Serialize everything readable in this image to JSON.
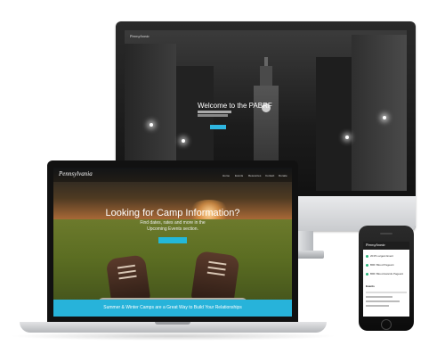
{
  "imac": {
    "logo_text": "Pennsylvania",
    "welcome_text": "Welcome to the PABRF"
  },
  "laptop": {
    "logo_text": "Pennsylvania",
    "nav_items": [
      "Home",
      "Events",
      "Resources",
      "Contact",
      "Donate"
    ],
    "headline": "Looking for Camp Information?",
    "sub_line1": "Find dates, rates and more in the",
    "sub_line2": "Upcoming Events section.",
    "banner_text": "Summer & Winter Camps are a Great Way to Build Your Relationships"
  },
  "phone": {
    "logo_text": "Pennsylvania",
    "rows": [
      "2015 Largest Event",
      "BRF Blood Pageant",
      "BRF Blood Awards Pageant"
    ],
    "section_label": "Events"
  },
  "colors": {
    "accent": "#27b3da",
    "phone_accent": "#2db37a"
  }
}
